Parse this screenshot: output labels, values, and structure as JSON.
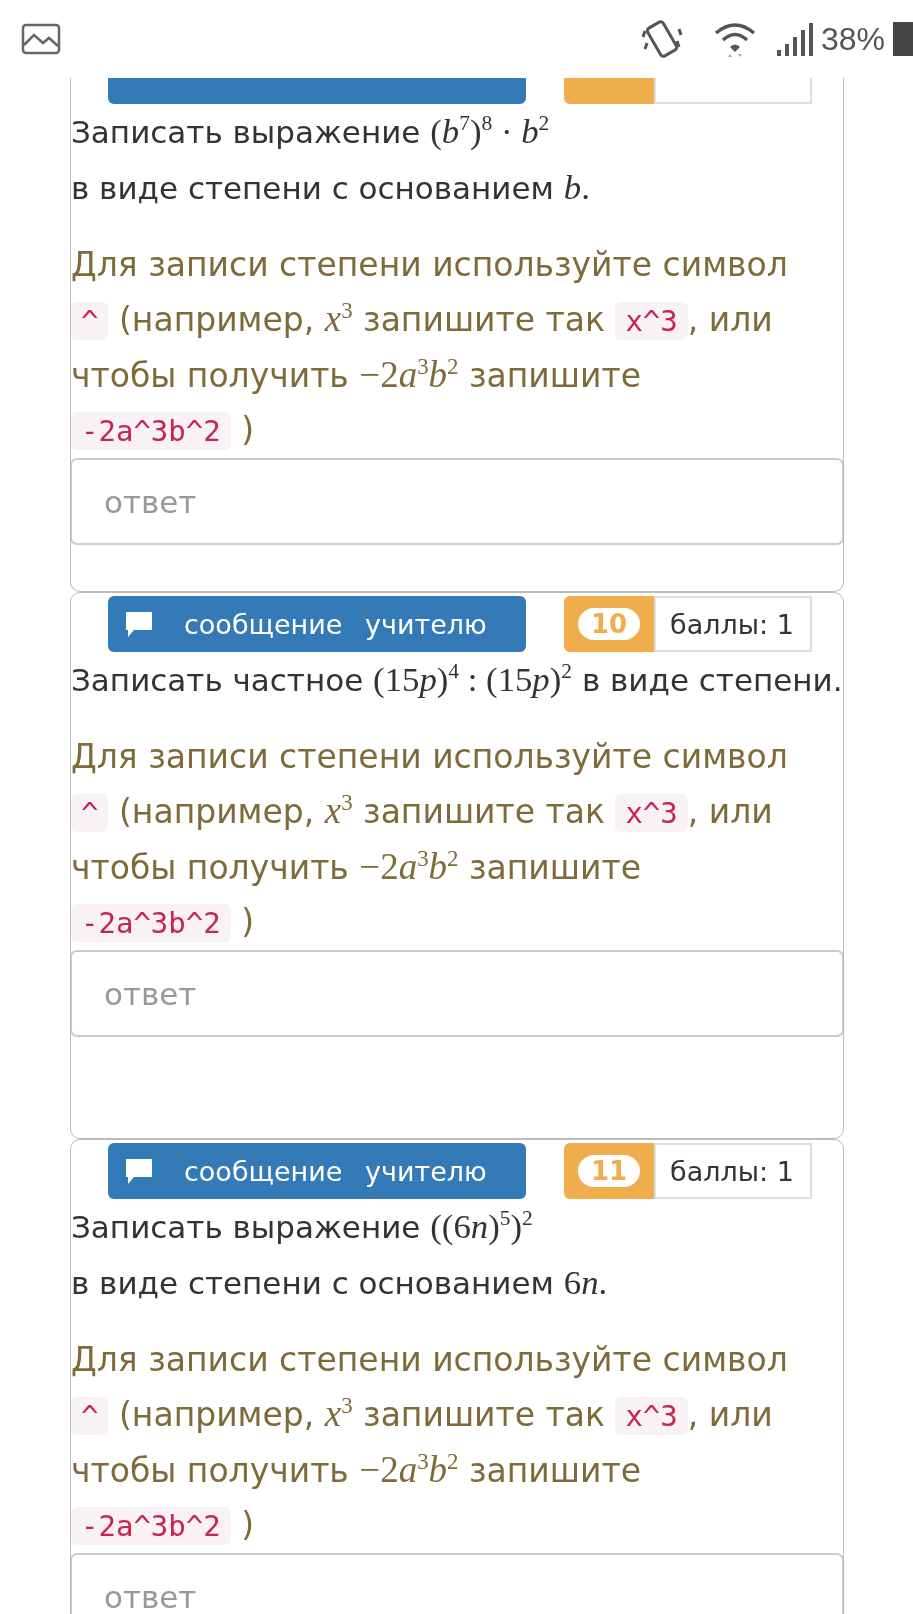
{
  "status_bar": {
    "battery": "38%"
  },
  "tasks": [
    {
      "header": {
        "partial": true
      },
      "question": [
        [
          {
            "kind": "text",
            "text": "Записать выражение "
          },
          {
            "kind": "math",
            "text": "("
          },
          {
            "kind": "var",
            "text": "b"
          },
          {
            "kind": "math",
            "text": "$^{7}$)$^{8}$ · "
          },
          {
            "kind": "var",
            "text": "b"
          },
          {
            "kind": "math",
            "text": "$^{2}$"
          }
        ],
        [
          {
            "kind": "text",
            "text": "в виде степени с основанием "
          },
          {
            "kind": "var",
            "text": "b"
          },
          {
            "kind": "math",
            "text": "."
          }
        ]
      ],
      "hint": [
        {
          "kind": "text",
          "text": "Для записи степени используйте символ "
        },
        {
          "kind": "code",
          "text": "^"
        },
        {
          "kind": "text",
          "text": " (например, "
        },
        {
          "kind": "var",
          "text": "x"
        },
        {
          "kind": "math",
          "text": "$^{3}$"
        },
        {
          "kind": "text",
          "text": " запишите так "
        },
        {
          "kind": "code",
          "text": "x^3"
        },
        {
          "kind": "text",
          "text": ", или чтобы получить "
        },
        {
          "kind": "math",
          "text": "−2"
        },
        {
          "kind": "var",
          "text": "a"
        },
        {
          "kind": "math",
          "text": "$^{3}$"
        },
        {
          "kind": "var",
          "text": "b"
        },
        {
          "kind": "math",
          "text": "$^{2}$"
        },
        {
          "kind": "text",
          "text": " запишите "
        },
        {
          "kind": "code",
          "text": "-2a^3b^2"
        },
        {
          "kind": "text",
          "text": " )"
        }
      ],
      "answer": {
        "placeholder": "ответ"
      }
    },
    {
      "header": {
        "message_button": "сообщение учителю",
        "number": "10",
        "points": "баллы: 1"
      },
      "question": [
        [
          {
            "kind": "text",
            "text": "Записать частное "
          },
          {
            "kind": "math",
            "text": "(15"
          },
          {
            "kind": "var",
            "text": "p"
          },
          {
            "kind": "math",
            "text": ")$^{4}$ : (15"
          },
          {
            "kind": "var",
            "text": "p"
          },
          {
            "kind": "math",
            "text": ")$^{2}$"
          },
          {
            "kind": "text",
            "text": " в виде степени."
          }
        ]
      ],
      "hint": [
        {
          "kind": "text",
          "text": "Для записи степени используйте символ "
        },
        {
          "kind": "code",
          "text": "^"
        },
        {
          "kind": "text",
          "text": " (например, "
        },
        {
          "kind": "var",
          "text": "x"
        },
        {
          "kind": "math",
          "text": "$^{3}$"
        },
        {
          "kind": "text",
          "text": " запишите так "
        },
        {
          "kind": "code",
          "text": "x^3"
        },
        {
          "kind": "text",
          "text": ", или чтобы получить "
        },
        {
          "kind": "math",
          "text": "−2"
        },
        {
          "kind": "var",
          "text": "a"
        },
        {
          "kind": "math",
          "text": "$^{3}$"
        },
        {
          "kind": "var",
          "text": "b"
        },
        {
          "kind": "math",
          "text": "$^{2}$"
        },
        {
          "kind": "text",
          "text": " запишите "
        },
        {
          "kind": "code",
          "text": "-2a^3b^2"
        },
        {
          "kind": "text",
          "text": " )"
        }
      ],
      "answer": {
        "placeholder": "ответ"
      }
    },
    {
      "header": {
        "message_button": "сообщение учителю",
        "number": "11",
        "points": "баллы: 1"
      },
      "question": [
        [
          {
            "kind": "text",
            "text": "Записать выражение "
          },
          {
            "kind": "math",
            "text": "((6"
          },
          {
            "kind": "var",
            "text": "n"
          },
          {
            "kind": "math",
            "text": ")$^{5}$)$^{2}$"
          }
        ],
        [
          {
            "kind": "text",
            "text": "в виде степени с основанием "
          },
          {
            "kind": "math",
            "text": "6"
          },
          {
            "kind": "var",
            "text": "n"
          },
          {
            "kind": "math",
            "text": "."
          }
        ]
      ],
      "hint": [
        {
          "kind": "text",
          "text": "Для записи степени используйте символ "
        },
        {
          "kind": "code",
          "text": "^"
        },
        {
          "kind": "text",
          "text": " (например, "
        },
        {
          "kind": "var",
          "text": "x"
        },
        {
          "kind": "math",
          "text": "$^{3}$"
        },
        {
          "kind": "text",
          "text": " запишите так "
        },
        {
          "kind": "code",
          "text": "x^3"
        },
        {
          "kind": "text",
          "text": ", или чтобы получить "
        },
        {
          "kind": "math",
          "text": "−2"
        },
        {
          "kind": "var",
          "text": "a"
        },
        {
          "kind": "math",
          "text": "$^{3}$"
        },
        {
          "kind": "var",
          "text": "b"
        },
        {
          "kind": "math",
          "text": "$^{2}$"
        },
        {
          "kind": "text",
          "text": " запишите "
        },
        {
          "kind": "code",
          "text": "-2a^3b^2"
        },
        {
          "kind": "text",
          "text": " )"
        }
      ],
      "answer": {
        "placeholder": "ответ"
      }
    }
  ]
}
